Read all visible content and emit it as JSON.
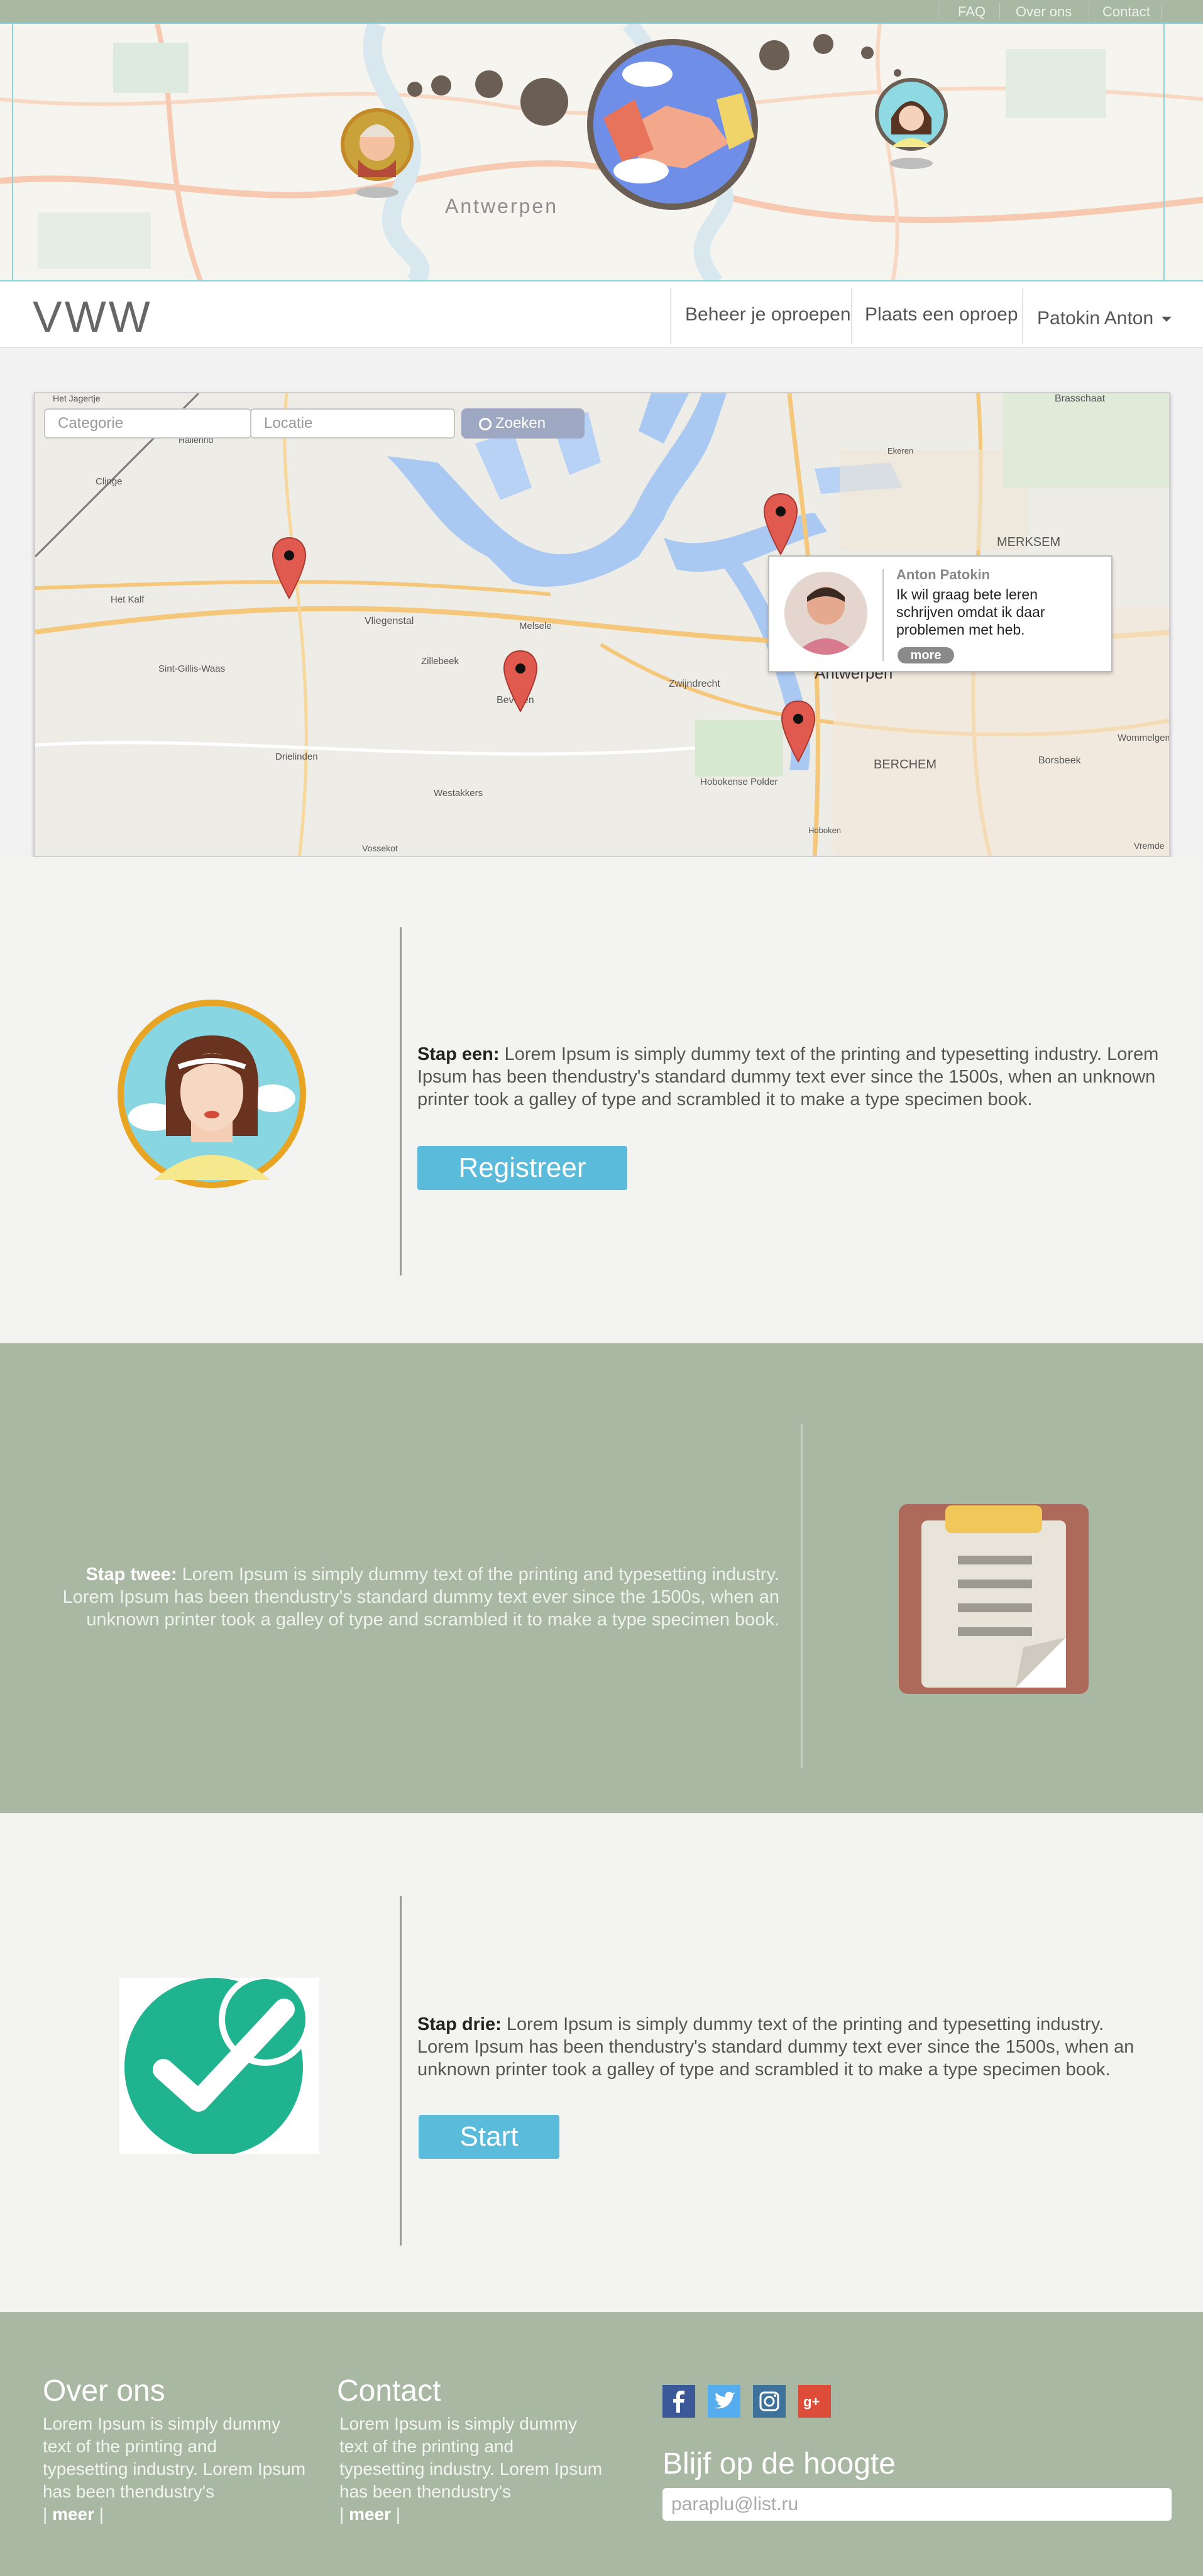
{
  "topbar": {
    "links": [
      "FAQ",
      "Over ons",
      "Contact"
    ]
  },
  "hero": {
    "city_label": "Antwerpen"
  },
  "navbar": {
    "logo": "VWW",
    "items": [
      "Beheer je oproepen",
      "Plaats een oproep"
    ],
    "user": "Patokin Anton"
  },
  "search": {
    "categorie_placeholder": "Categorie",
    "locatie_placeholder": "Locatie",
    "button_label": "Zoeken"
  },
  "map": {
    "labels": [
      "Het Jagertje",
      "Hallerind",
      "Clinge",
      "Het Kalf",
      "Sint-Gillis-Waas",
      "Vliegenstal",
      "Zillebeek",
      "Melsele",
      "Beveren",
      "Drielinden",
      "Westakkers",
      "Vossekot",
      "Zwijndrecht",
      "Antwerpen",
      "Hobokense Polder",
      "MERKSEM",
      "BERCHEM",
      "Borsbeek",
      "Wommelgem",
      "Brasschaat",
      "Ekeren",
      "Hoboken",
      "Vremde"
    ],
    "popup": {
      "name": "Anton Patokin",
      "text": "Ik wil graag bete leren schrijven omdat ik daar problemen met heb.",
      "more": "more"
    }
  },
  "steps": [
    {
      "label": "Stap een:",
      "text": "Lorem Ipsum is simply dummy text of the printing and typesetting industry. Lorem Ipsum has been thendustry's standard dummy text ever since the 1500s, when an unknown printer took a galley of type and scrambled it to make a type specimen book.",
      "button": "Registreer"
    },
    {
      "label": "Stap twee:",
      "text": "Lorem Ipsum is simply dummy text of the printing and typesetting industry. Lorem Ipsum has been thendustry's standard dummy text ever since the 1500s, when an unknown printer took a galley of type and scrambled it to make a type specimen book."
    },
    {
      "label": "Stap drie:",
      "text": "Lorem Ipsum is simply dummy text of the printing and typesetting industry. Lorem Ipsum has been thendustry's standard dummy text ever since the 1500s, when an unknown printer took a galley of type and scrambled it to make a type specimen book.",
      "button": "Start"
    }
  ],
  "footer": {
    "about": {
      "title": "Over ons",
      "text": "Lorem Ipsum is simply dummy text of the printing and typesetting industry. Lorem Ipsum has been thendustry's",
      "more": "meer"
    },
    "contact": {
      "title": "Contact",
      "text": "Lorem Ipsum is simply dummy text of the printing and typesetting industry. Lorem Ipsum has been thendustry's",
      "more": "meer"
    },
    "social_icons": [
      "facebook-icon",
      "twitter-icon",
      "instagram-icon",
      "google-plus-icon"
    ],
    "newsletter": {
      "title": "Blijf op de hoogte",
      "placeholder": "paraplu@list.ru"
    }
  },
  "colors": {
    "sage": "#a9b8a3",
    "accent_blue": "#5bbbdb",
    "pin_red": "#e05a4f"
  }
}
